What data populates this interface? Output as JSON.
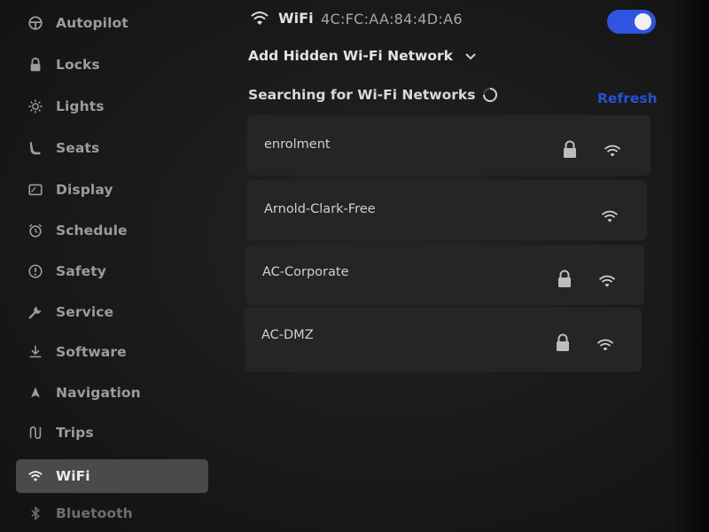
{
  "sidebar": {
    "items": [
      {
        "label": "Autopilot",
        "icon": "steering-wheel-icon"
      },
      {
        "label": "Locks",
        "icon": "lock-icon"
      },
      {
        "label": "Lights",
        "icon": "sun-icon"
      },
      {
        "label": "Seats",
        "icon": "seat-icon"
      },
      {
        "label": "Display",
        "icon": "display-icon"
      },
      {
        "label": "Schedule",
        "icon": "alarm-clock-icon"
      },
      {
        "label": "Safety",
        "icon": "alert-circle-icon"
      },
      {
        "label": "Service",
        "icon": "wrench-icon"
      },
      {
        "label": "Software",
        "icon": "download-icon"
      },
      {
        "label": "Navigation",
        "icon": "navigation-arrow-icon"
      },
      {
        "label": "Trips",
        "icon": "trips-icon"
      },
      {
        "label": "WiFi",
        "icon": "wifi-icon",
        "active": true
      },
      {
        "label": "Bluetooth",
        "icon": "bluetooth-icon"
      }
    ]
  },
  "wifi": {
    "title": "WiFi",
    "mac": "4C:FC:AA:84:4D:A6",
    "enabled": true,
    "toggle_color": "#2f55e0",
    "add_hidden_label": "Add Hidden Wi-Fi Network",
    "searching_label": "Searching for Wi-Fi Networks",
    "refresh_label": "Refresh",
    "accent": "#2d4fd6"
  },
  "networks": [
    {
      "name": "enrolment",
      "secured": true
    },
    {
      "name": "Arnold-Clark-Free",
      "secured": false
    },
    {
      "name": "AC-Corporate",
      "secured": true
    },
    {
      "name": "AC-DMZ",
      "secured": true
    }
  ]
}
